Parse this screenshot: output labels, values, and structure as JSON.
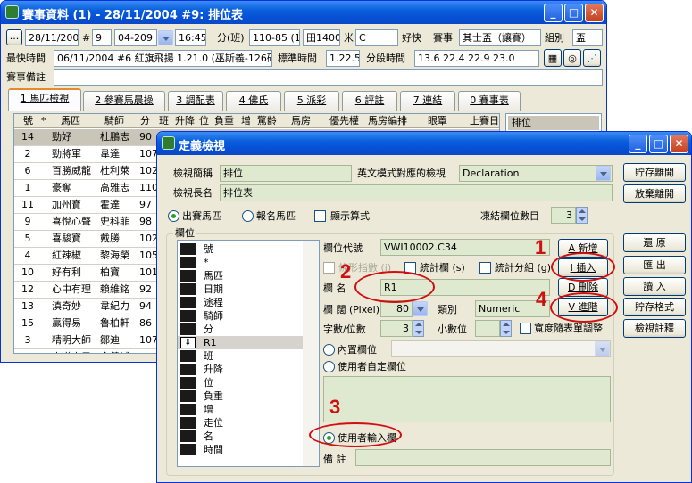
{
  "main": {
    "title": "賽事資料 (1) - 28/11/2004 #9: 排位表",
    "row1": {
      "date": "28/11/2004",
      "hash": "#",
      "race_no": "9",
      "code": "04-209",
      "time": "16:45",
      "fen_label": "分(班)",
      "class_range": "110-85 (1)",
      "course": "田1400",
      "meter_label": "米",
      "going_code": "C",
      "going": "好快",
      "event_label": "賽事",
      "event": "其士盃（讓賽）",
      "group_label": "組別",
      "group": "盃"
    },
    "row2": {
      "fastest_label": "最快時間",
      "fastest": "06/11/2004 #6 紅旗飛揚 1.21.0 (巫斯義-126磅)",
      "std_label": "標準時間",
      "std": "1.22.5",
      "split_label": "分段時間",
      "split": "13.6  22.4  22.9  23.0"
    },
    "row3": {
      "note_label": "賽事備註"
    },
    "tabs": [
      "1 馬匹檢視",
      "2 參賽馬晨操",
      "3 調配表",
      "4 佛氏",
      "5 派彩",
      "6 評註",
      "7 連結",
      "0 賽事表"
    ],
    "grid_headers": [
      "號",
      "*",
      "馬匹",
      "騎師",
      "分",
      "班",
      "升降",
      "位",
      "負重",
      "增",
      "驚齡",
      "馬房",
      "優先權",
      "馬房編排",
      "眼罩",
      "上賽日"
    ],
    "side_item": "排位",
    "rows": [
      {
        "no": "14",
        "horse": "勁好",
        "jockey": "杜鵬志",
        "score": "90"
      },
      {
        "no": "2",
        "horse": "勁將軍",
        "jockey": "韋達",
        "score": "107"
      },
      {
        "no": "6",
        "horse": "百勝威龍",
        "jockey": "杜利萊",
        "score": "102"
      },
      {
        "no": "1",
        "horse": "豪奪",
        "jockey": "高雅志",
        "score": "110"
      },
      {
        "no": "11",
        "horse": "加州寶",
        "jockey": "霍達",
        "score": "97"
      },
      {
        "no": "9",
        "horse": "喜悅心聲",
        "jockey": "史科菲",
        "score": "98"
      },
      {
        "no": "5",
        "horse": "喜駿寶",
        "jockey": "戴勝",
        "score": "102"
      },
      {
        "no": "4",
        "horse": "紅辣椒",
        "jockey": "黎海榮",
        "score": "105"
      },
      {
        "no": "10",
        "horse": "好有利",
        "jockey": "柏寶",
        "score": "101"
      },
      {
        "no": "12",
        "horse": "心中有理",
        "jockey": "賴維銘",
        "score": "92"
      },
      {
        "no": "13",
        "horse": "滇奇妙",
        "jockey": "韋紀力",
        "score": "94"
      },
      {
        "no": "15",
        "horse": "贏得易",
        "jockey": "魯柏軒",
        "score": "86"
      },
      {
        "no": "3",
        "horse": "精明大師",
        "jockey": "鄒迪",
        "score": "107"
      },
      {
        "no": "8",
        "horse": "赤道小子",
        "jockey": "余健誠",
        "score": "98"
      }
    ]
  },
  "dialog": {
    "title": "定義檢視",
    "short_name_label": "檢視簡稱",
    "short_name": "排位",
    "en_label": "英文模式對應的檢視",
    "en_value": "Declaration",
    "long_name_label": "檢視長名",
    "long_name": "排位表",
    "radio_runners": "出賽馬匹",
    "radio_entries": "報名馬匹",
    "show_formula": "顯示算式",
    "frozen_label": "凍結欄位數目",
    "frozen": "3",
    "group_label": "欄位",
    "field_list": [
      "號",
      "*",
      "馬匹",
      "日期",
      "途程",
      "騎師",
      "分",
      "R1",
      "班",
      "升降",
      "位",
      "負重",
      "增",
      "走位",
      "名",
      "時間"
    ],
    "selected_index": 7,
    "code_label": "欄位代號",
    "code": "VWI10002.C34",
    "chk_color": "條形指數 (i)",
    "chk_stats": "統計欄 (s)",
    "chk_group": "統計分組 (g)",
    "name_label": "欄 名",
    "name": "R1",
    "width_label": "欄 闊 (Pixel)",
    "width": "80",
    "type_label": "類別",
    "type": "Numeric",
    "digits_label": "字數/位數",
    "digits": "3",
    "decimals_label": "小數位",
    "auto_width": "寬度隨表單調整",
    "radio_builtin": "內置欄位",
    "radio_custom": "使用者自定欄位",
    "radio_input": "使用者輸入欄",
    "remark_label": "備 註",
    "btn_new": "A 新增",
    "btn_insert": "I 插入",
    "btn_delete": "D 刪除",
    "btn_advanced": "V 進階",
    "btn_save_leave": "貯存離開",
    "btn_discard": "放棄離開",
    "btn_restore": "還 原",
    "btn_export": "匯 出",
    "btn_import": "讀 入",
    "btn_save_format": "貯存格式",
    "btn_notes": "檢視註釋",
    "annot": [
      "1",
      "2",
      "3",
      "4"
    ]
  }
}
